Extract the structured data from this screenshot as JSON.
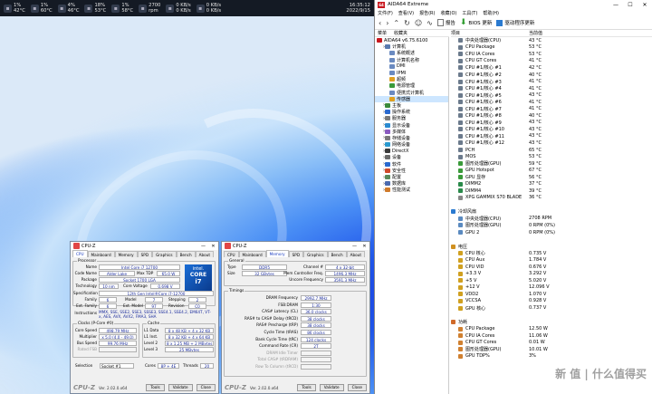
{
  "topbar": {
    "items": [
      {
        "icon": "cpu-icon",
        "l1": "1%",
        "l2": "42°C"
      },
      {
        "icon": "gpu-icon",
        "l1": "1%",
        "l2": "60°C"
      },
      {
        "icon": "ram-icon",
        "l1": "4%",
        "l2": "46°C"
      },
      {
        "icon": "disk-icon",
        "l1": "18%",
        "l2": "53°C"
      },
      {
        "icon": "disk2-icon",
        "l1": "1%",
        "l2": "58°C"
      },
      {
        "icon": "fan-icon",
        "l1": "2700",
        "l2": "rpm"
      },
      {
        "icon": "speed-icon",
        "l1": "0 KB/s",
        "l2": "0 KB/s"
      },
      {
        "icon": "net-icon",
        "l1": "0 KB/s",
        "l2": "0 KB/s"
      }
    ],
    "time": "16:35:12",
    "date": "2022/9/15"
  },
  "aida": {
    "title": "AIDA64 Extreme",
    "menu": [
      "文件(F)",
      "查看(V)",
      "报告(R)",
      "收藏(O)",
      "工具(T)",
      "帮助(H)"
    ],
    "toolbar": {
      "report": "报告",
      "bios": "BIOS 更新",
      "driver": "驱动程序更新"
    },
    "col_menu": "菜单",
    "col_fav": "收藏夹",
    "col_item": "项目",
    "col_value": "当前值",
    "tree": [
      {
        "t": "AIDA64 v6.75.6100",
        "d": 0,
        "c": "#c8171e"
      },
      {
        "t": "计算机",
        "d": 1,
        "c": "#5a7bb0"
      },
      {
        "t": "系统概述",
        "d": 2,
        "c": "#6a8ac0"
      },
      {
        "t": "计算机名称",
        "d": 2,
        "c": "#6a8ac0"
      },
      {
        "t": "DMI",
        "d": 2,
        "c": "#6a8ac0"
      },
      {
        "t": "IPMI",
        "d": 2,
        "c": "#6a8ac0"
      },
      {
        "t": "超频",
        "d": 2,
        "c": "#e0a020"
      },
      {
        "t": "电源管理",
        "d": 2,
        "c": "#3a9a3a"
      },
      {
        "t": "便携式计算机",
        "d": 2,
        "c": "#6a8ac0"
      },
      {
        "t": "传感器",
        "d": 2,
        "c": "#e0a020",
        "sel": true
      },
      {
        "t": "主板",
        "d": 1,
        "c": "#3a8a3a"
      },
      {
        "t": "操作系统",
        "d": 1,
        "c": "#2a6ad0"
      },
      {
        "t": "服务器",
        "d": 1,
        "c": "#7a7a7a"
      },
      {
        "t": "显示设备",
        "d": 1,
        "c": "#2a8ad0"
      },
      {
        "t": "多媒体",
        "d": 1,
        "c": "#8a5ac0"
      },
      {
        "t": "存储设备",
        "d": 1,
        "c": "#7a7a7a"
      },
      {
        "t": "网络设备",
        "d": 1,
        "c": "#2a9ad0"
      },
      {
        "t": "DirectX",
        "d": 1,
        "c": "#3a3a3a"
      },
      {
        "t": "设备",
        "d": 1,
        "c": "#6a6a6a"
      },
      {
        "t": "软件",
        "d": 1,
        "c": "#2a6ad0"
      },
      {
        "t": "安全性",
        "d": 1,
        "c": "#d04a2a"
      },
      {
        "t": "配置",
        "d": 1,
        "c": "#5a8a5a"
      },
      {
        "t": "数据库",
        "d": 1,
        "c": "#4a6ab0"
      },
      {
        "t": "性能测试",
        "d": 1,
        "c": "#d07a2a"
      }
    ],
    "sensors": [
      {
        "n": "中央处理器(CPU)",
        "v": "43 °C",
        "ic": "chip"
      },
      {
        "n": "CPU Package",
        "v": "53 °C",
        "ic": "chip"
      },
      {
        "n": "CPU IA Cores",
        "v": "53 °C",
        "ic": "chip"
      },
      {
        "n": "CPU GT Cores",
        "v": "41 °C",
        "ic": "chip"
      },
      {
        "n": "CPU #1/核心 #1",
        "v": "42 °C",
        "ic": "chip"
      },
      {
        "n": "CPU #1/核心 #2",
        "v": "40 °C",
        "ic": "chip"
      },
      {
        "n": "CPU #1/核心 #3",
        "v": "41 °C",
        "ic": "chip"
      },
      {
        "n": "CPU #1/核心 #4",
        "v": "41 °C",
        "ic": "chip"
      },
      {
        "n": "CPU #1/核心 #5",
        "v": "43 °C",
        "ic": "chip"
      },
      {
        "n": "CPU #1/核心 #6",
        "v": "41 °C",
        "ic": "chip"
      },
      {
        "n": "CPU #1/核心 #7",
        "v": "41 °C",
        "ic": "chip"
      },
      {
        "n": "CPU #1/核心 #8",
        "v": "40 °C",
        "ic": "chip"
      },
      {
        "n": "CPU #1/核心 #9",
        "v": "43 °C",
        "ic": "chip"
      },
      {
        "n": "CPU #1/核心 #10",
        "v": "43 °C",
        "ic": "chip"
      },
      {
        "n": "CPU #1/核心 #11",
        "v": "43 °C",
        "ic": "chip"
      },
      {
        "n": "CPU #1/核心 #12",
        "v": "43 °C",
        "ic": "chip"
      },
      {
        "n": "PCH",
        "v": "65 °C",
        "ic": "chip"
      },
      {
        "n": "MOS",
        "v": "53 °C",
        "ic": "chip"
      },
      {
        "n": "图形处理器(GPU)",
        "v": "59 °C",
        "ic": "gpu"
      },
      {
        "n": "GPU Hotspot",
        "v": "67 °C",
        "ic": "gpu"
      },
      {
        "n": "GPU 显存",
        "v": "56 °C",
        "ic": "gpu"
      },
      {
        "n": "DIMM2",
        "v": "37 °C",
        "ic": "mem"
      },
      {
        "n": "DIMM4",
        "v": "39 °C",
        "ic": "mem"
      },
      {
        "n": "XPG GAMMIX S70 BLADE",
        "v": "36 °C",
        "ic": "disk"
      }
    ],
    "fans_title": "冷却风扇",
    "fans": [
      {
        "n": "中央处理器(CPU)",
        "v": "2708 RPM"
      },
      {
        "n": "图形处理器(GPU)",
        "v": "0 RPM (0%)"
      },
      {
        "n": "GPU 2",
        "v": "0 RPM (0%)"
      }
    ],
    "volt_title": "电压",
    "volts": [
      {
        "n": "CPU 核心",
        "v": "0.735 V"
      },
      {
        "n": "CPU Aux",
        "v": "1.784 V"
      },
      {
        "n": "CPU VID",
        "v": "0.676 V"
      },
      {
        "n": "+3.3 V",
        "v": "3.292 V"
      },
      {
        "n": "+5 V",
        "v": "5.020 V"
      },
      {
        "n": "+12 V",
        "v": "12.096 V"
      },
      {
        "n": "VDD2",
        "v": "1.070 V"
      },
      {
        "n": "VCCSA",
        "v": "0.928 V"
      },
      {
        "n": "GPU 核心",
        "v": "0.737 V"
      }
    ],
    "power_title": "功耗",
    "powers": [
      {
        "n": "CPU Package",
        "v": "12.50 W"
      },
      {
        "n": "CPU IA Cores",
        "v": "11.06 W"
      },
      {
        "n": "CPU GT Cores",
        "v": "0.01 W"
      },
      {
        "n": "图形处理器(GPU)",
        "v": "10.01 W"
      },
      {
        "n": "GPU TDP%",
        "v": "3%"
      }
    ]
  },
  "cpuz1": {
    "title": "CPU-Z",
    "tabs": [
      "CPU",
      "Mainboard",
      "Memory",
      "SPD",
      "Graphics",
      "Bench",
      "About"
    ],
    "processor": "Processor",
    "name_l": "Name",
    "name": "Intel Core i7 12700",
    "code_l": "Code Name",
    "code": "Alder Lake",
    "tdp_l": "Max TDP",
    "tdp": "65.0 W",
    "pkg_l": "Package",
    "pkg": "Socket 1700 LGA",
    "tech_l": "Technology",
    "tech": "10 nm",
    "cv_l": "Core Voltage",
    "cv": "0.698 V",
    "spec_l": "Specification",
    "spec": "12th Gen Intel®Core i7-12700",
    "fam_l": "Family",
    "fam": "6",
    "mod_l": "Model",
    "mod": "7",
    "step_l": "Stepping",
    "step": "2",
    "efam_l": "Ext. Family",
    "efam": "6",
    "emod_l": "Ext. Model",
    "emod": "97",
    "rev_l": "Revision",
    "rev": "C0",
    "ins_l": "Instructions",
    "ins": "MMX, SSE, SSE2, SSE3, SSSE3, SSE4.1, SSE4.2, EM64T, VT-x, AES, AVX, AVX2, FMA3, SHA",
    "clocks": "Clocks (P-Core #0)",
    "cs_l": "Core Speed",
    "cs": "498.79 MHz",
    "mul_l": "Multiplier",
    "mul": "x 5.0 (4.0 - 49.0)",
    "bs_l": "Bus Speed",
    "bs": "99.76 MHz",
    "rf_l": "Rated FSB",
    "cache": "Cache",
    "l1d_l": "L1 Data",
    "l1d": "8 x 48 KB + 4 x 32 KB",
    "l1i_l": "L1 Inst.",
    "l1i": "8 x 32 KB + 4 x 64 KB",
    "l2_l": "Level 2",
    "l2": "8 x 1.25 MB + 2 MBytes",
    "l3_l": "Level 3",
    "l3": "25 MBytes",
    "sel_l": "Selection",
    "sel": "Socket #1",
    "cores_l": "Cores",
    "cores": "8P + 4E",
    "thr_l": "Threads",
    "thr": "20",
    "brand": "CPU-Z",
    "ver": "Ver. 2.02.0.x64",
    "tools": "Tools",
    "validate": "Validate",
    "close": "Close",
    "intel_t": "intel.",
    "intel_c": "CORE",
    "intel_i": "i7"
  },
  "cpuz2": {
    "title": "CPU-Z",
    "tabs": [
      "CPU",
      "Mainboard",
      "Memory",
      "SPD",
      "Graphics",
      "Bench",
      "About"
    ],
    "general": "General",
    "type_l": "Type",
    "type": "DDR5",
    "ch_l": "Channel #",
    "ch": "4 x 32-bit",
    "size_l": "Size",
    "size": "32 GBytes",
    "mc_l": "Mem Controller Freq.",
    "mc": "1496.3 MHz",
    "uf_l": "Uncore Frequency",
    "uf": "3591.3 MHz",
    "timings": "Timings",
    "df_l": "DRAM Frequency",
    "df": "2992.7 MHz",
    "fsb_l": "FSB:DRAM",
    "fsb": "1:30",
    "cl_l": "CAS# Latency (CL)",
    "cl": "36.0 clocks",
    "rcd_l": "RAS# to CAS# Delay (tRCD)",
    "rcd": "38 clocks",
    "rp_l": "RAS# Precharge (tRP)",
    "rp": "38 clocks",
    "ras_l": "Cycle Time (tRAS)",
    "ras": "86 clocks",
    "rc_l": "Bank Cycle Time (tRC)",
    "rc": "124 clocks",
    "cr_l": "Command Rate (CR)",
    "cr": "2T",
    "idle_l": "DRAM Idle Timer",
    "trdram_l": "Total CAS# (tRDRAM)",
    "rtc_l": "Row To Column (tRCD)",
    "brand": "CPU-Z",
    "ver": "Ver. 2.02.0.x64",
    "tools": "Tools",
    "validate": "Validate",
    "close": "Close"
  },
  "watermark": "新 值 | 什么值得买"
}
